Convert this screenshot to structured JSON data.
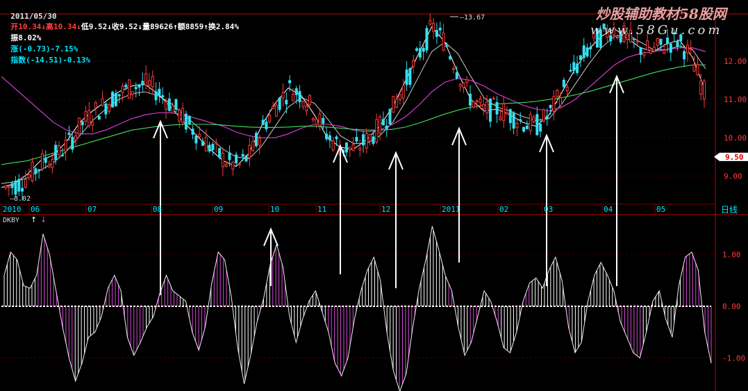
{
  "header": {
    "date": "2011/05/30",
    "open_label": "开",
    "open_value": "10.34",
    "high_label": "高",
    "high_value": "10.34",
    "low_label": "低",
    "low_value": "9.52",
    "close_label": "收",
    "close_value": "9.52",
    "volume_label": "量",
    "volume_value": "89626",
    "amount_label": "额",
    "amount_value": "8859",
    "turnover_label": "换",
    "turnover_value": "2.84%",
    "amplitude_label": "振",
    "amplitude_value": "8.02%",
    "change_label": "涨",
    "change_value": "(-0.73)-7.15%",
    "index_label": "指数",
    "index_value": "(-14.51)-0.13%"
  },
  "watermark": {
    "line1": "炒股辅助教材58股网",
    "line2": "www.58Gu.com"
  },
  "colors": {
    "up": "#ff3b3b",
    "down": "#35e0f0",
    "ma5": "#ffffff",
    "ma10": "#ffffff",
    "ma20": "#e040e0",
    "ma60": "#40e060",
    "axis_text": "#00e5ff",
    "frame": "#c00000",
    "osc_up": "#ffffff",
    "osc_down": "#d64bd6",
    "wm1": "#e7a0a0",
    "wm2": "#e0e0e0"
  },
  "chart_data": [
    {
      "type": "candlestick",
      "title": "",
      "period_label": "日线",
      "x_tick_labels": [
        "2010",
        "06",
        "07",
        "08",
        "09",
        "10",
        "11",
        "12",
        "2011",
        "02",
        "03",
        "04",
        "05"
      ],
      "y_tick_labels": [
        "9.00",
        "10.00",
        "11.00",
        "12.00"
      ],
      "ylim": [
        8.3,
        13.2
      ],
      "current_price": "9.50",
      "max_label": "13.67",
      "min_label": "8.02",
      "series": [
        {
          "name": "MA5",
          "values": [
            8.7,
            8.8,
            9.05,
            9.4,
            9.55,
            9.9,
            10.4,
            10.7,
            10.95,
            11.2,
            11.35,
            11.4,
            11.15,
            10.8,
            10.4,
            10.05,
            9.7,
            9.4,
            9.25,
            9.6,
            10.35,
            10.9,
            11.3,
            11.1,
            10.6,
            10.0,
            9.75,
            9.7,
            9.95,
            10.3,
            10.8,
            11.5,
            12.2,
            12.9,
            12.5,
            11.7,
            11.0,
            10.7,
            10.75,
            10.6,
            10.4,
            10.3,
            10.6,
            11.2,
            11.8,
            12.3,
            12.65,
            12.85,
            12.6,
            12.35,
            12.25,
            12.45,
            12.55,
            12.1,
            11.2
          ]
        },
        {
          "name": "MA10",
          "values": [
            8.8,
            8.85,
            8.95,
            9.15,
            9.35,
            9.65,
            10.05,
            10.45,
            10.75,
            11.0,
            11.15,
            11.2,
            11.1,
            10.9,
            10.6,
            10.3,
            10.0,
            9.7,
            9.5,
            9.45,
            9.8,
            10.3,
            10.8,
            11.05,
            10.9,
            10.5,
            10.05,
            9.85,
            9.85,
            10.05,
            10.4,
            10.95,
            11.6,
            12.25,
            12.5,
            12.2,
            11.6,
            11.05,
            10.8,
            10.7,
            10.55,
            10.45,
            10.5,
            10.9,
            11.4,
            11.9,
            12.35,
            12.65,
            12.7,
            12.5,
            12.3,
            12.3,
            12.4,
            12.3,
            11.8
          ]
        },
        {
          "name": "MA20",
          "values": [
            11.6,
            11.3,
            11.0,
            10.7,
            10.4,
            10.2,
            10.1,
            10.1,
            10.2,
            10.35,
            10.5,
            10.6,
            10.65,
            10.65,
            10.6,
            10.5,
            10.4,
            10.3,
            10.15,
            10.05,
            10.0,
            10.0,
            10.1,
            10.25,
            10.35,
            10.35,
            10.3,
            10.2,
            10.15,
            10.2,
            10.35,
            10.55,
            10.85,
            11.2,
            11.45,
            11.55,
            11.5,
            11.35,
            11.15,
            11.0,
            10.85,
            10.75,
            10.7,
            10.8,
            11.0,
            11.3,
            11.6,
            11.9,
            12.1,
            12.2,
            12.25,
            12.3,
            12.35,
            12.35,
            12.25
          ]
        },
        {
          "name": "MA60",
          "values": [
            9.3,
            9.35,
            9.4,
            9.5,
            9.6,
            9.7,
            9.8,
            9.9,
            10.0,
            10.1,
            10.2,
            10.25,
            10.3,
            10.33,
            10.35,
            10.35,
            10.35,
            10.33,
            10.3,
            10.28,
            10.27,
            10.27,
            10.28,
            10.3,
            10.3,
            10.28,
            10.25,
            10.22,
            10.2,
            10.2,
            10.22,
            10.28,
            10.38,
            10.5,
            10.62,
            10.72,
            10.8,
            10.85,
            10.88,
            10.9,
            10.92,
            10.95,
            11.0,
            11.05,
            11.12,
            11.2,
            11.3,
            11.4,
            11.5,
            11.6,
            11.7,
            11.78,
            11.85,
            11.9,
            11.9
          ]
        }
      ],
      "annotations": [
        "↑",
        "↑",
        "↑",
        "↑",
        "↑",
        "↑",
        "↑",
        "↑"
      ]
    },
    {
      "type": "bar",
      "title": "DKBY",
      "legend_arrows": [
        "↑",
        "↓"
      ],
      "y_tick_labels": [
        "1.00",
        "0.00",
        "-1.00"
      ],
      "ylim": [
        -1.6,
        1.6
      ],
      "values": [
        0.6,
        1.05,
        0.9,
        0.4,
        0.35,
        0.6,
        1.4,
        1.0,
        0.3,
        -0.4,
        -1.0,
        -1.45,
        -1.1,
        -0.6,
        -0.5,
        -0.2,
        0.35,
        0.6,
        0.3,
        -0.6,
        -0.95,
        -0.7,
        -0.4,
        -0.2,
        0.25,
        0.6,
        0.3,
        0.2,
        0.1,
        -0.5,
        -0.85,
        -0.4,
        0.45,
        1.05,
        0.9,
        0.2,
        -0.8,
        -1.5,
        -0.95,
        -0.3,
        0.15,
        0.8,
        1.2,
        0.75,
        -0.2,
        -0.7,
        -0.25,
        0.1,
        0.3,
        -0.1,
        -0.5,
        -1.1,
        -1.35,
        -1.0,
        -0.25,
        0.3,
        0.7,
        0.95,
        0.5,
        -0.5,
        -1.25,
        -1.65,
        -1.3,
        -0.4,
        0.35,
        0.9,
        1.55,
        1.1,
        0.6,
        0.3,
        -0.4,
        -0.95,
        -0.7,
        -0.2,
        0.3,
        0.1,
        -0.3,
        -0.8,
        -0.9,
        -0.5,
        0.1,
        0.45,
        0.55,
        0.35,
        0.7,
        0.95,
        0.5,
        -0.4,
        -0.9,
        -0.7,
        0.1,
        0.6,
        0.85,
        0.6,
        0.3,
        -0.3,
        -0.6,
        -0.9,
        -1.0,
        -0.5,
        0.1,
        0.3,
        -0.25,
        -0.6,
        0.4,
        0.95,
        1.05,
        0.7,
        -0.5,
        -1.1
      ]
    }
  ]
}
